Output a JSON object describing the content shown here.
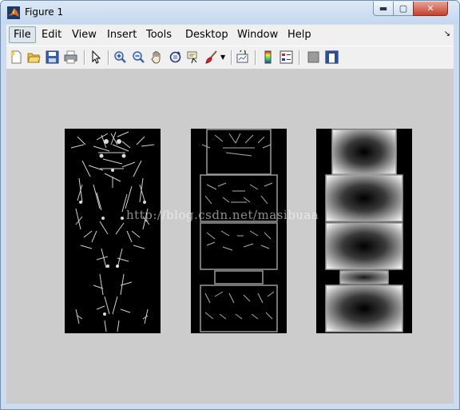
{
  "window": {
    "title": "Figure 1"
  },
  "menu": [
    "File",
    "Edit",
    "View",
    "Insert",
    "Tools",
    "Desktop",
    "Window",
    "Help"
  ],
  "toolbar": {
    "buttons": [
      "new-figure-icon",
      "open-file-icon",
      "save-figure-icon",
      "print-figure-icon",
      "edit-plot-icon",
      "zoom-in-icon",
      "zoom-out-icon",
      "pan-icon",
      "rotate-3d-icon",
      "data-cursor-icon",
      "brush-icon",
      "link-plot-icon",
      "colorbar-icon",
      "legend-icon",
      "hide-plot-tools-icon",
      "show-plot-tools-icon"
    ]
  },
  "watermark": "http://blog.csdn.net/masibuaa",
  "colors": {
    "canvas": "#cccccc",
    "panel": "#000000",
    "accent": "#dcdcdc"
  }
}
